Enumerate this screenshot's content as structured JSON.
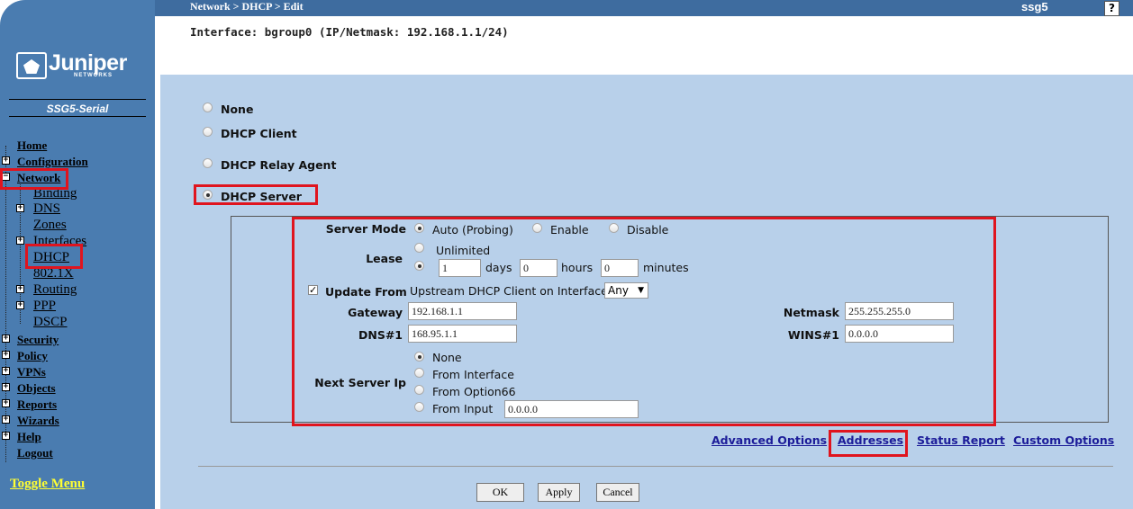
{
  "header": {
    "breadcrumb": "Network > DHCP > Edit",
    "hostname": "ssg5",
    "help_label": "?",
    "interface_line": "Interface: bgroup0 (IP/Netmask: 192.168.1.1/24)"
  },
  "sidebar": {
    "logo_word": "Juniper",
    "logo_sub": "NETWORKS",
    "model": "SSG5-Serial",
    "items": {
      "home": "Home",
      "configuration": "Configuration",
      "network": "Network",
      "binding": "Binding",
      "dns": "DNS",
      "zones": "Zones",
      "interfaces": "Interfaces",
      "dhcp": "DHCP",
      "dot1x": "802.1X",
      "routing": "Routing",
      "ppp": "PPP",
      "dscp": "DSCP",
      "security": "Security",
      "policy": "Policy",
      "vpns": "VPNs",
      "objects": "Objects",
      "reports": "Reports",
      "wizards": "Wizards",
      "help": "Help",
      "logout": "Logout"
    },
    "toggle_menu": "Toggle Menu"
  },
  "mode": {
    "none": "None",
    "client": "DHCP Client",
    "relay": "DHCP Relay Agent",
    "server": "DHCP Server",
    "selected": "DHCP Server"
  },
  "server": {
    "server_mode_label": "Server Mode",
    "server_mode_options": [
      "Auto (Probing)",
      "Enable",
      "Disable"
    ],
    "server_mode_selected": "Auto (Probing)",
    "lease_label": "Lease",
    "lease_unlimited": "Unlimited",
    "lease_days_value": "1",
    "lease_days_unit": "days",
    "lease_hours_value": "0",
    "lease_hours_unit": "hours",
    "lease_minutes_value": "0",
    "lease_minutes_unit": "minutes",
    "update_from_label": "Update From",
    "update_from_checked": true,
    "update_from_text": "Upstream DHCP Client on Interface",
    "update_from_select": "Any",
    "gateway_label": "Gateway",
    "gateway_value": "192.168.1.1",
    "netmask_label": "Netmask",
    "netmask_value": "255.255.255.0",
    "dns1_label": "DNS#1",
    "dns1_value": "168.95.1.1",
    "wins1_label": "WINS#1",
    "wins1_value": "0.0.0.0",
    "next_server_label": "Next Server Ip",
    "next_server_options": [
      "None",
      "From Interface",
      "From Option66",
      "From Input"
    ],
    "next_server_selected": "None",
    "next_server_input_value": "0.0.0.0"
  },
  "links": {
    "advanced": "Advanced Options",
    "addresses": "Addresses",
    "status": "Status Report",
    "custom": "Custom Options"
  },
  "buttons": {
    "ok": "OK",
    "apply": "Apply",
    "cancel": "Cancel"
  },
  "colors": {
    "sidebar": "#4a7cb0",
    "header": "#3e6c9f",
    "panel": "#b8d0ea",
    "highlight": "#e0141e"
  }
}
